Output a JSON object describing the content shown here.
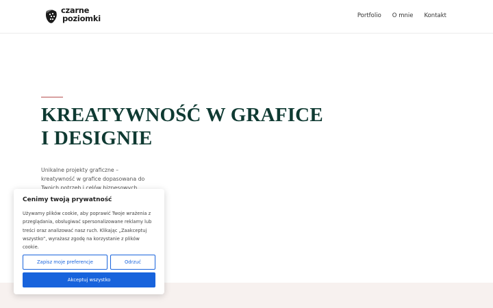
{
  "header": {
    "logo": {
      "line1": "czarne",
      "line2": "poziomki"
    },
    "nav": [
      {
        "label": "Portfolio"
      },
      {
        "label": "O mnie"
      },
      {
        "label": "Kontakt"
      }
    ]
  },
  "hero": {
    "title": "KREATYWNOŚĆ W GRAFICE I DESIGNIE",
    "description": "Unikalne projekty graficzne – kreatywność w grafice dopasowana do Twoich potrzeb i celów biznesowych."
  },
  "cookie": {
    "title": "Cenimy twoją prywatność",
    "text": "Używamy plików cookie, aby poprawić Twoje wrażenia z przeglądania, obsługiwać spersonalizowane reklamy lub treści oraz analizować nasz ruch. Klikając „Zaakceptuj wszystko”, wyrażasz zgodę na korzystanie z plików cookie.",
    "preferences_label": "Zapisz moje preferencje",
    "reject_label": "Odrzuć",
    "accept_label": "Akceptuj wszystko"
  },
  "colors": {
    "accent": "#1863dc",
    "title": "#0f3a32",
    "hero_line": "#d8a0a0",
    "band": "#f7f1ef"
  }
}
